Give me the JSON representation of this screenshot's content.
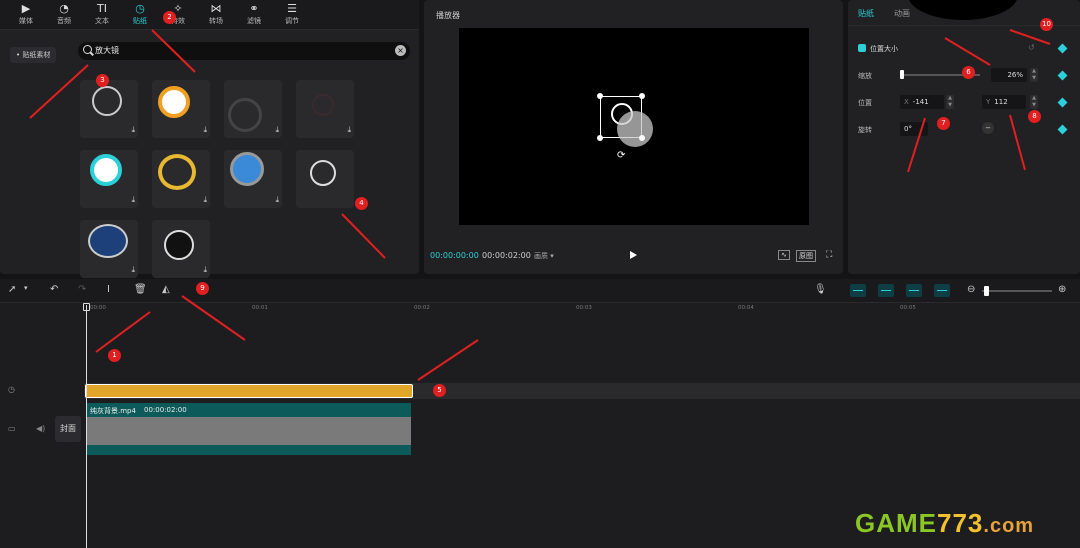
{
  "library": {
    "tabs": [
      {
        "label": "媒体",
        "icon": "media-icon"
      },
      {
        "label": "音频",
        "icon": "audio-icon"
      },
      {
        "label": "文本",
        "icon": "text-icon"
      },
      {
        "label": "贴纸",
        "icon": "sticker-icon"
      },
      {
        "label": "特效",
        "icon": "effects-icon"
      },
      {
        "label": "转场",
        "icon": "transition-icon"
      },
      {
        "label": "滤镜",
        "icon": "filter-icon"
      },
      {
        "label": "调节",
        "icon": "adjust-icon"
      }
    ],
    "active_tab": "贴纸",
    "side_item": "• 贴纸素材",
    "search_value": "放大镜",
    "stickers_count_visible": 10
  },
  "player": {
    "title": "播放器",
    "current_time": "00:00:00:00",
    "duration": "00:00:02:00",
    "ratio_label": "画质 ▾",
    "btn_original": "原图"
  },
  "inspector": {
    "tabs": [
      "贴纸",
      "动画"
    ],
    "section_label": "位置大小",
    "scale_label": "缩放",
    "scale_value": "26%",
    "position_label": "位置",
    "x_prefix": "X",
    "x_value": "-141",
    "y_prefix": "Y",
    "y_value": "112",
    "rotation_label": "旋转",
    "rotation_value": "0°"
  },
  "timeline": {
    "ruler": [
      "00:00",
      "00:01",
      "00:02",
      "00:03",
      "00:04",
      "00:05"
    ],
    "video_clip_name": "纯灰背景.mp4",
    "video_clip_duration": "00:00:02:00",
    "cover_label": "封面"
  },
  "annotations": [
    "1",
    "2",
    "3",
    "4",
    "5",
    "6",
    "7",
    "8",
    "9",
    "10"
  ],
  "watermark": {
    "part1": "GAME",
    "part2": "773",
    "part3": ".com"
  },
  "colors": {
    "accent": "#2bd0d8",
    "sticker_clip": "#e0a62a",
    "badge": "#e02020"
  }
}
